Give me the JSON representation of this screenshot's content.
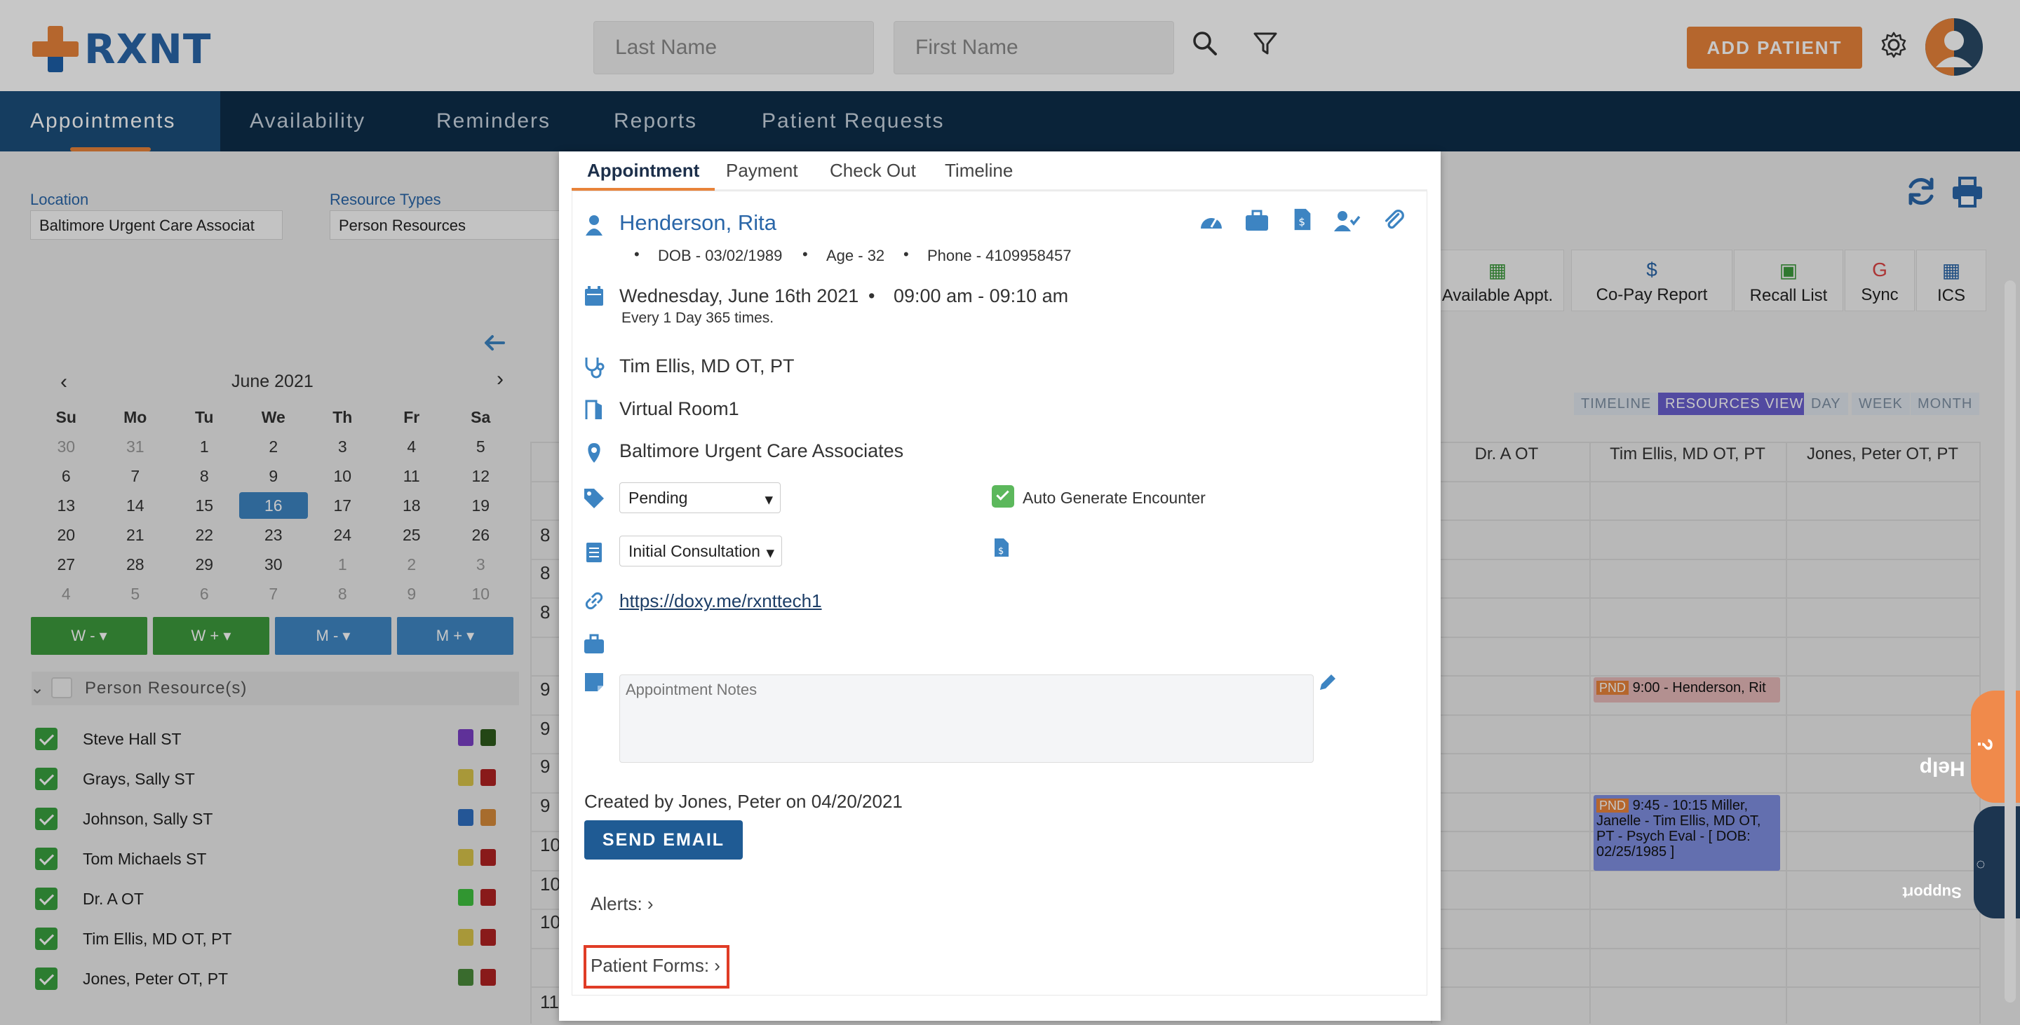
{
  "header": {
    "logo_text": "RXNT",
    "last_name_placeholder": "Last Name",
    "first_name_placeholder": "First Name",
    "add_patient_label": "ADD PATIENT"
  },
  "nav": {
    "items": [
      "Appointments",
      "Availability",
      "Reminders",
      "Reports",
      "Patient Requests"
    ],
    "active": "Appointments"
  },
  "filters": {
    "location_label": "Location",
    "location_value": "Baltimore Urgent Care Associat",
    "resource_types_label": "Resource Types",
    "resource_types_value": "Person Resources"
  },
  "calendar": {
    "month": "June 2021",
    "weekdays": [
      "Su",
      "Mo",
      "Tu",
      "We",
      "Th",
      "Fr",
      "Sa"
    ],
    "weeks": [
      [
        "30",
        "31",
        "1",
        "2",
        "3",
        "4",
        "5"
      ],
      [
        "6",
        "7",
        "8",
        "9",
        "10",
        "11",
        "12"
      ],
      [
        "13",
        "14",
        "15",
        "16",
        "17",
        "18",
        "19"
      ],
      [
        "20",
        "21",
        "22",
        "23",
        "24",
        "25",
        "26"
      ],
      [
        "27",
        "28",
        "29",
        "30",
        "1",
        "2",
        "3"
      ],
      [
        "4",
        "5",
        "6",
        "7",
        "8",
        "9",
        "10"
      ]
    ],
    "selected_day": "16",
    "nav_buttons": [
      "W -",
      "W +",
      "M -",
      "M +"
    ]
  },
  "resources": {
    "header": "Person Resource(s)",
    "items": [
      {
        "name": "Steve Hall ST",
        "colors": [
          "#7a3fc4",
          "#2e5a1c"
        ]
      },
      {
        "name": "Grays, Sally ST",
        "colors": [
          "#d8c34a",
          "#b02222"
        ]
      },
      {
        "name": "Johnson, Sally ST",
        "colors": [
          "#2f6fc0",
          "#d68b3a"
        ]
      },
      {
        "name": "Tom Michaels ST",
        "colors": [
          "#d8c34a",
          "#b02222"
        ]
      },
      {
        "name": "Dr. A OT",
        "colors": [
          "#3fc03f",
          "#b02222"
        ]
      },
      {
        "name": "Tim Ellis, MD OT, PT",
        "colors": [
          "#d8c34a",
          "#b02222"
        ]
      },
      {
        "name": "Jones, Peter OT, PT",
        "colors": [
          "#4a8a3a",
          "#b02222"
        ]
      }
    ]
  },
  "toolbar": {
    "buttons": [
      "Available Appt.",
      "Co-Pay Report",
      "Recall List",
      "Sync",
      "ICS"
    ]
  },
  "views": [
    "TIMELINE",
    "RESOURCES VIEW",
    "DAY",
    "WEEK",
    "MONTH"
  ],
  "schedule": {
    "columns": [
      "Dr. A OT",
      "Tim Ellis, MD OT, PT",
      "Jones, Peter OT, PT"
    ],
    "row_labels": [
      "8",
      "8",
      "8",
      "9",
      "9",
      "9",
      "9",
      "10",
      "10",
      "10",
      "11"
    ],
    "events": [
      {
        "badge": "PND",
        "text": "9:00 - Henderson, Rit"
      },
      {
        "badge": "PND",
        "text": "9:45 - 10:15 Miller, Janelle - Tim Ellis, MD OT, PT - Psych Eval - [ DOB: 02/25/1985 ]"
      }
    ]
  },
  "modal": {
    "tabs": [
      "Appointment",
      "Payment",
      "Check Out",
      "Timeline"
    ],
    "patient_name": "Henderson, Rita",
    "dob": "DOB - 03/02/1989",
    "age": "Age - 32",
    "phone": "Phone - 4109958457",
    "date": "Wednesday, June 16th 2021",
    "time": "09:00 am - 09:10 am",
    "recurrence": "Every 1 Day 365 times.",
    "provider": "Tim Ellis, MD OT, PT",
    "room": "Virtual Room1",
    "location": "Baltimore Urgent Care Associates",
    "status": "Pending",
    "auto_generate_label": "Auto Generate Encounter",
    "appointment_type": "Initial Consultation",
    "link": "https://doxy.me/rxnttech1",
    "notes_placeholder": "Appointment Notes",
    "created_by": "Created by Jones, Peter on 04/20/2021",
    "send_email_label": "SEND EMAIL",
    "alerts_label": "Alerts:",
    "patient_forms_label": "Patient Forms:"
  },
  "help": {
    "help_label": "Help",
    "support_label": "Support"
  },
  "colors": {
    "brand_orange": "#e8833a",
    "brand_blue": "#2a66a8",
    "nav_bg": "#0e2d4a",
    "highlight_red": "#e03c26"
  }
}
